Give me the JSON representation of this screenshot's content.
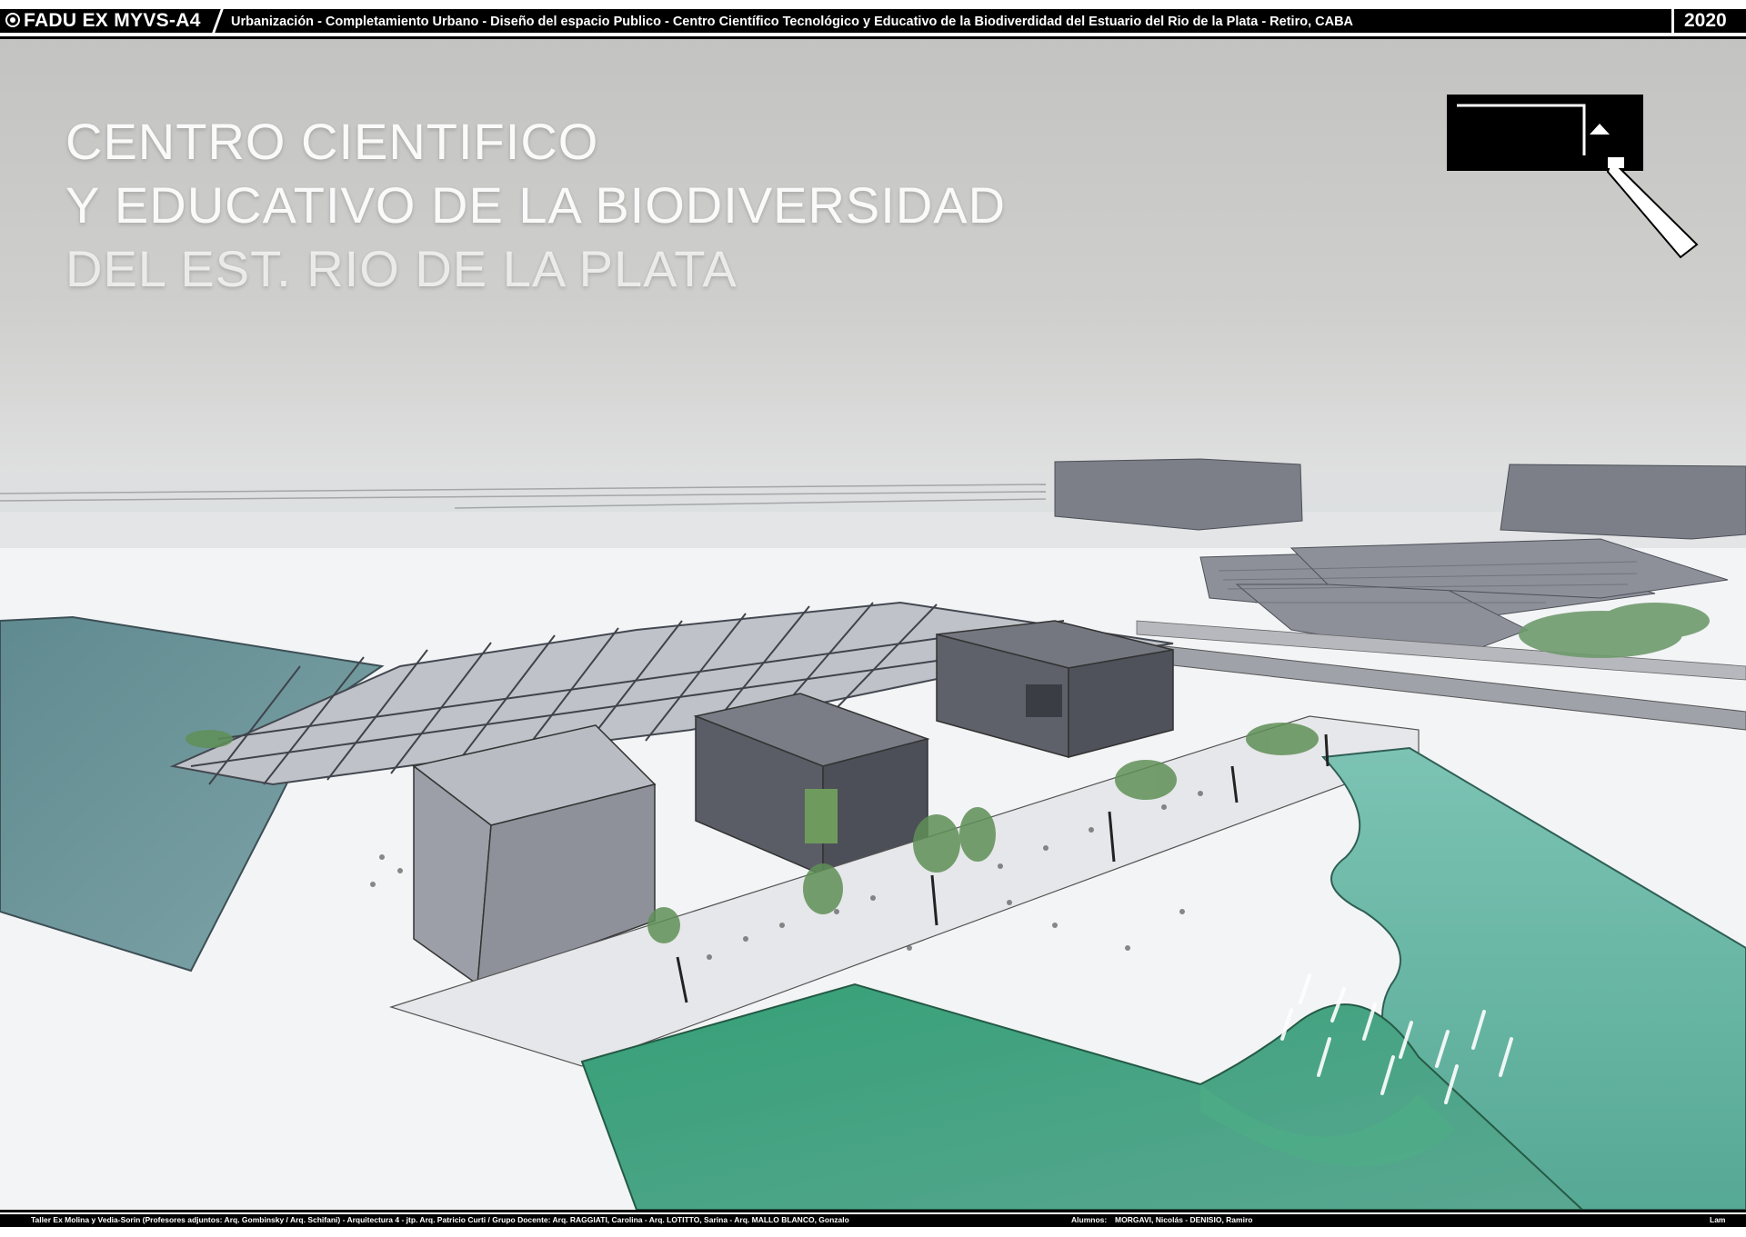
{
  "header": {
    "code": "FADU EX MYVS-A4",
    "subject": "Urbanización - Completamiento Urbano - Diseño del espacio Publico - Centro Científico Tecnológico y Educativo de la Biodiverdidad del Estuario del Rio de la Plata   - Retiro, CABA",
    "year": "2020"
  },
  "title": {
    "line1": "CENTRO CIENTIFICO",
    "line2": "Y EDUCATIVO DE LA BIODIVERSIDAD",
    "line3": "DEL EST. RIO DE LA PLATA"
  },
  "footer": {
    "credits": "Taller Ex Molina y Vedia-Sorin (Profesores adjuntos:  Arq. Gombinsky / Arq. Schifani) - Arquitectura 4 - jtp. Arq. Patricio Curti / Grupo Docente:      Arq. RAGGIATI, Carolina - Arq. LOTITTO, Sarina - Arq. MALLO BLANCO, Gonzalo",
    "students_label": "Alumnos:",
    "students": "MORGAVI, Nicolás - DENISIO, Ramiro",
    "sheet": "Lam"
  },
  "colors": {
    "sky": "#c9c9c6",
    "water_blue": "#6f9aa0",
    "water_green": "#3fa57e",
    "building": "#6c6f78",
    "ground": "#f2f3f5"
  }
}
